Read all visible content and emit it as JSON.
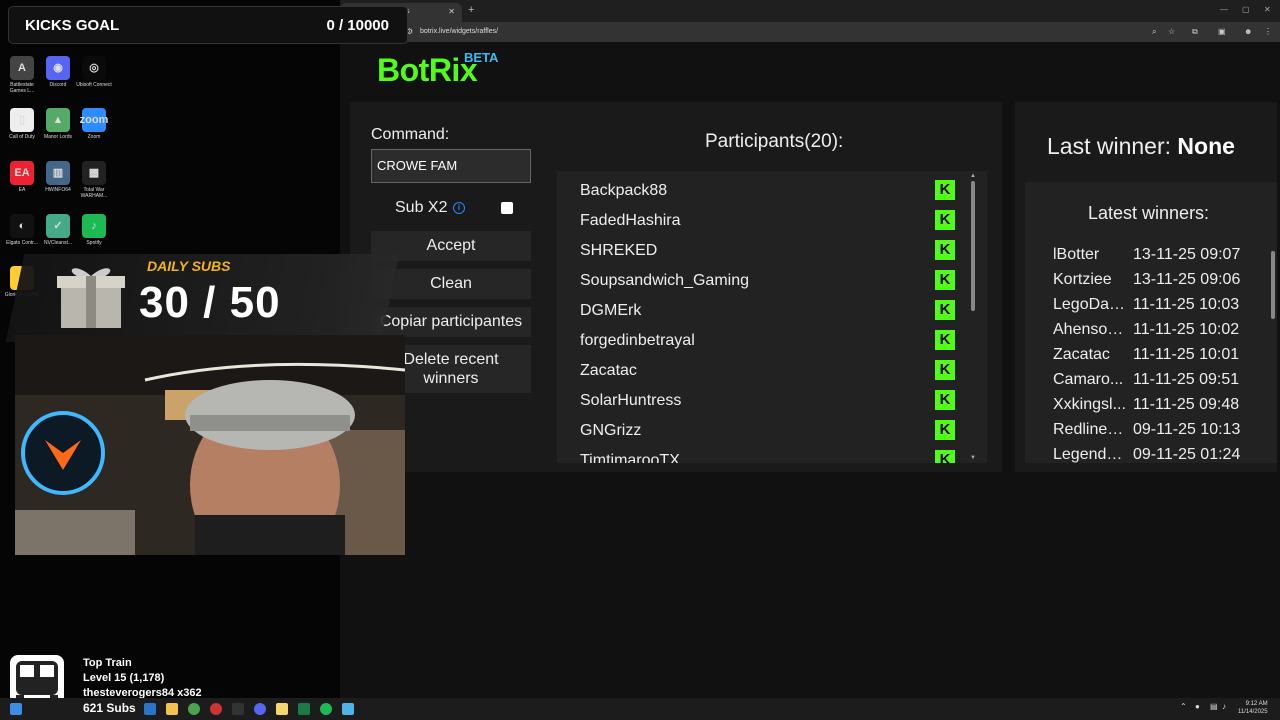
{
  "desktop": {
    "icons": [
      {
        "label": "Battlestate Games L...",
        "glyph": "A",
        "color": "#444"
      },
      {
        "label": "Discord",
        "glyph": "◉",
        "color": "#5865f2"
      },
      {
        "label": "Ubisoft Connect",
        "glyph": "◎",
        "color": "#0a0a0a"
      },
      {
        "label": "Call of Duty",
        "glyph": "▯",
        "color": "#eee"
      },
      {
        "label": "Manor Lords",
        "glyph": "▲",
        "color": "#5a6"
      },
      {
        "label": "Zoom",
        "glyph": "zoom",
        "color": "#2d8cff"
      },
      {
        "label": "EA",
        "glyph": "EA",
        "color": "#e23"
      },
      {
        "label": "HWiNFO64",
        "glyph": "▥",
        "color": "#468"
      },
      {
        "label": "Total War WARHAM...",
        "glyph": "▩",
        "color": "#222"
      },
      {
        "label": "Elgato Contr...",
        "glyph": "◐",
        "color": "#111"
      },
      {
        "label": "NVCleanst...",
        "glyph": "✓",
        "color": "#4a8"
      },
      {
        "label": "Spotify",
        "glyph": "♪",
        "color": "#1db954"
      },
      {
        "label": "Glorious CORE",
        "glyph": "◭",
        "color": "#fc3"
      }
    ]
  },
  "browser": {
    "tab_title": "s",
    "url": "botrix.live/widgets/raffles/"
  },
  "app": {
    "logo": "BotRix",
    "beta": "BETA",
    "command_label": "Command:",
    "command_value": "CROWE FAM",
    "sub_label": "Sub X2",
    "buttons": {
      "accept": "Accept",
      "clean": "Clean",
      "copy": "Copiar participantes",
      "delete": "Delete recent winners"
    },
    "participants_title": "Participants(20):",
    "participants": [
      "Backpack88",
      "FadedHashira",
      "SHREKED",
      "Soupsandwich_Gaming",
      "DGMErk",
      "forgedinbetrayal",
      "Zacatac",
      "SolarHuntress",
      "GNGrizz",
      "TimtimarooTX"
    ],
    "last_winner_label": "Last winner:",
    "last_winner_value": "None",
    "latest_winners_title": "Latest winners:",
    "winners": [
      {
        "name": "lBotter",
        "time": "13-11-25 09:07"
      },
      {
        "name": "Kortziee",
        "time": "13-11-25 09:06"
      },
      {
        "name": "LegoDad...",
        "time": "11-11-25 10:03"
      },
      {
        "name": "Ahenson...",
        "time": "11-11-25 10:02"
      },
      {
        "name": "Zacatac",
        "time": "11-11-25 10:01"
      },
      {
        "name": "Camaro...",
        "time": "11-11-25 09:51"
      },
      {
        "name": "Xxkingsl...",
        "time": "11-11-25 09:48"
      },
      {
        "name": "Redline_...",
        "time": "09-11-25 10:13"
      },
      {
        "name": "Legend1...",
        "time": "09-11-25 01:24"
      }
    ]
  },
  "overlay": {
    "goal_label": "KICKS GOAL",
    "goal_value": "0 / 10000",
    "daily_label": "DAILY SUBS",
    "daily_value": "30 / 50",
    "train_title": "Top Train",
    "train_level": "Level 15  (1,178)",
    "train_user": "thesteverogers84 x362",
    "subs_total": "621 Subs"
  },
  "taskbar": {
    "time": "9:12 AM",
    "date": "11/14/2025"
  }
}
